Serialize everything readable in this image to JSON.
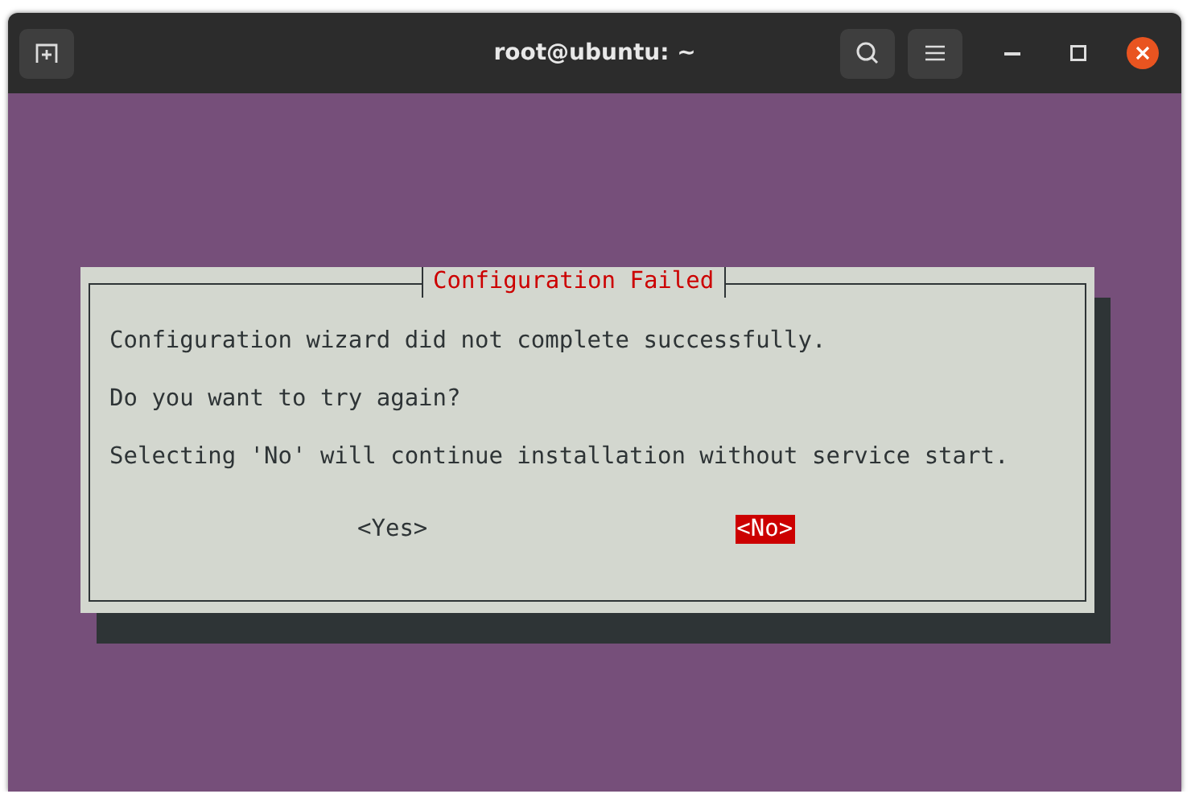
{
  "window": {
    "title": "root@ubuntu: ~"
  },
  "dialog": {
    "title": "Configuration Failed",
    "lines": [
      "Configuration wizard did not complete successfully.",
      "Do you want to try again?",
      "Selecting 'No' will continue installation without service start."
    ],
    "buttons": [
      {
        "label": "<Yes>",
        "selected": false
      },
      {
        "label": "<No>",
        "selected": true
      }
    ]
  }
}
